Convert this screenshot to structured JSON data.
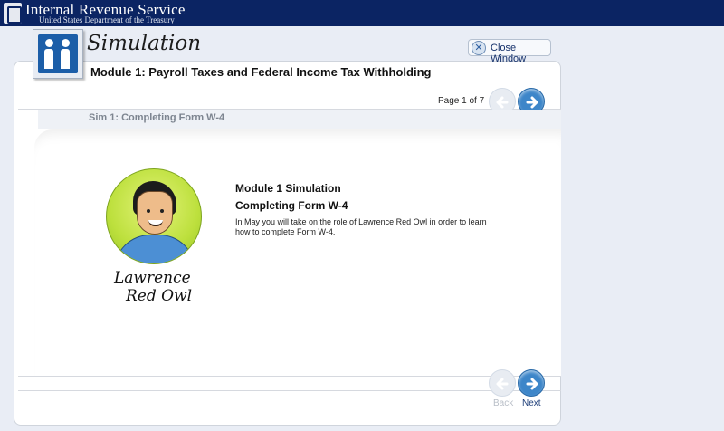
{
  "header": {
    "title": "Internal Revenue Service",
    "subtitle": "United States Department of the Treasury"
  },
  "app": {
    "heading": "Simulation",
    "close_label": "Close Window"
  },
  "module": {
    "title": "Module 1: Payroll Taxes and Federal Income Tax Withholding"
  },
  "navigation": {
    "page_indicator": "Page 1 of 7",
    "back_label": "Back",
    "next_label": "Next",
    "back_enabled": false
  },
  "sim": {
    "label": "Sim 1: Completing Form W-4"
  },
  "content": {
    "heading": "Module 1 Simulation",
    "subheading": "Completing Form W-4",
    "body": "In May you will take on the role of Lawrence Red Owl in order to learn how to complete Form W-4."
  },
  "character": {
    "name_line1": "Lawrence",
    "name_line2": "Red Owl"
  },
  "colors": {
    "header_bg": "#0b2463",
    "next_button": "#3d86c9",
    "avatar_bg": "#bde03d"
  },
  "icons": [
    "irs-seal-icon",
    "simulation-logo-icon",
    "close-icon",
    "back-arrow-icon",
    "next-arrow-icon"
  ]
}
